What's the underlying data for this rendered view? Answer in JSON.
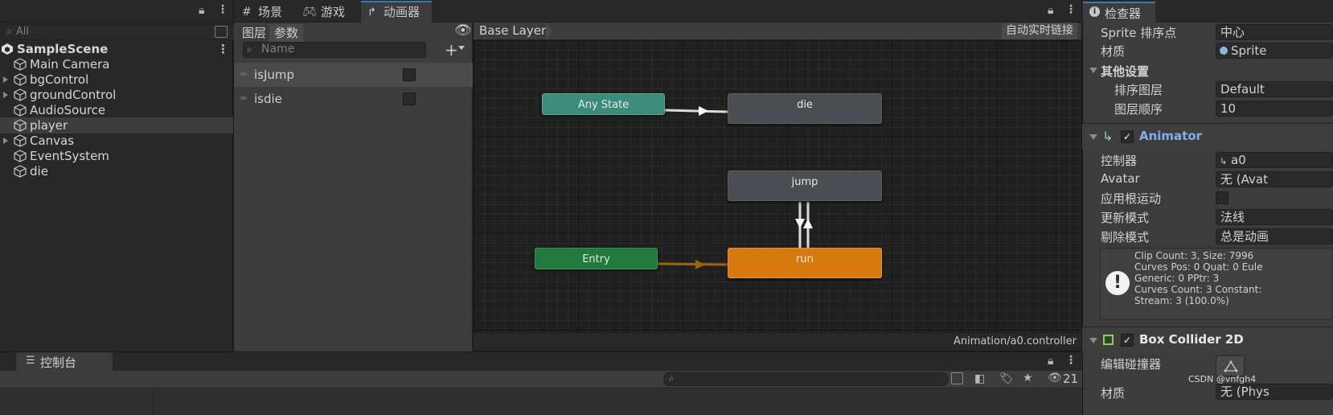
{
  "hierarchy": {
    "search_placeholder": "All",
    "scene": "SampleScene",
    "items": [
      {
        "label": "Main Camera"
      },
      {
        "label": "bgControl"
      },
      {
        "label": "groundControl"
      },
      {
        "label": "AudioSource"
      },
      {
        "label": "player"
      },
      {
        "label": "Canvas"
      },
      {
        "label": "EventSystem"
      },
      {
        "label": "die"
      }
    ]
  },
  "animator": {
    "tabs": [
      {
        "label": "场景"
      },
      {
        "label": "游戏"
      },
      {
        "label": "动画器"
      }
    ],
    "panel_tabs": [
      "图层",
      "参数"
    ],
    "param_search_placeholder": "Name",
    "add_label": "+",
    "parameters": [
      {
        "name": "isJump",
        "value": false
      },
      {
        "name": "isdie",
        "value": false
      }
    ],
    "breadcrumb": "Base Layer",
    "auto_live_link": "自动实时链接",
    "states": {
      "any_state": "Any State",
      "die": "die",
      "jump": "jump",
      "entry": "Entry",
      "run": "run"
    },
    "colors": {
      "any_state": "#3c8c7c",
      "entry": "#1f7a3c",
      "default_state": "#d67a0f",
      "state": "#4a4d52",
      "entry_transition": "#9a6410"
    },
    "footer_path": "Animation/a0.controller"
  },
  "console": {
    "tab_label": "控制台",
    "hidden_count": "21"
  },
  "inspector": {
    "tab_label": "检查器",
    "sprite_sort_point": {
      "label": "Sprite 排序点",
      "value": "中心"
    },
    "material": {
      "label": "材质",
      "value": "Sprite"
    },
    "other_settings": "其他设置",
    "sorting_layer": {
      "label": "排序图层",
      "value": "Default"
    },
    "order_in_layer": {
      "label": "图层顺序",
      "value": "10"
    },
    "animator_title": "Animator",
    "controller": {
      "label": "控制器",
      "value": "a0"
    },
    "avatar": {
      "label": "Avatar",
      "value": "无 (Avat"
    },
    "apply_root_motion": {
      "label": "应用根运动"
    },
    "update_mode": {
      "label": "更新模式",
      "value": "法线"
    },
    "culling_mode": {
      "label": "剔除模式",
      "value": "总是动画"
    },
    "info": [
      "Clip Count: 3, Size: 7996",
      "Curves Pos: 0 Quat: 0 Eule",
      "Generic: 0 PPtr: 3",
      "Curves Count: 3 Constant:",
      "Stream: 3 (100.0%)"
    ],
    "box_collider_title": "Box Collider 2D",
    "edit_collider": {
      "label": "编辑碰撞器"
    },
    "material2": {
      "label": "材质",
      "value": "无 (Phys"
    },
    "watermark": "CSDN @vnfgh4"
  }
}
